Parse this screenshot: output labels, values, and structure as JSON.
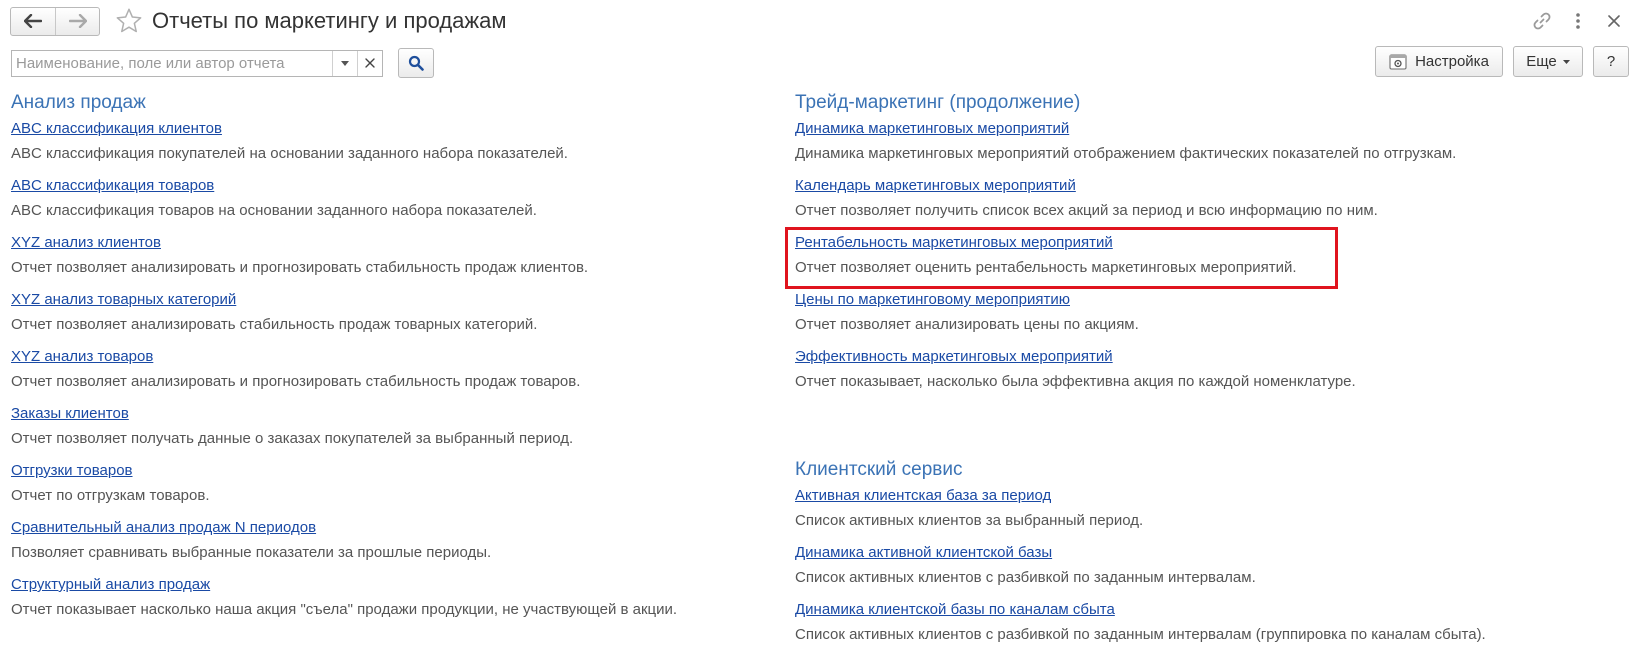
{
  "title": "Отчеты по маркетингу и продажам",
  "nav": {
    "back_icon": "arrow-left-icon",
    "forward_icon": "arrow-right-icon",
    "favorite_icon": "star-icon"
  },
  "window_icons": [
    "link-icon",
    "more-vertical-icon",
    "close-icon"
  ],
  "search": {
    "placeholder": "Наименование, поле или автор отчета",
    "value": ""
  },
  "toolbar": {
    "settings_label": "Настройка",
    "more_label": "Еще",
    "help_label": "?"
  },
  "left_column": {
    "sections": [
      {
        "title": "Анализ продаж",
        "reports": [
          {
            "name": "ABC классификация клиентов",
            "description": "ABC классификация покупателей на основании заданного набора показателей."
          },
          {
            "name": "ABC классификация товаров",
            "description": "ABC классификация товаров на основании заданного набора показателей."
          },
          {
            "name": "XYZ анализ клиентов",
            "description": "Отчет позволяет анализировать и прогнозировать стабильность продаж клиентов."
          },
          {
            "name": "XYZ анализ товарных категорий",
            "description": "Отчет позволяет анализировать стабильность продаж товарных категорий."
          },
          {
            "name": "XYZ анализ товаров",
            "description": "Отчет позволяет анализировать и прогнозировать стабильность продаж товаров."
          },
          {
            "name": "Заказы клиентов",
            "description": "Отчет позволяет получать данные о заказах покупателей за выбранный период."
          },
          {
            "name": "Отгрузки товаров",
            "description": "Отчет по отгрузкам товаров."
          },
          {
            "name": "Сравнительный анализ продаж N периодов",
            "description": "Позволяет сравнивать выбранные показатели за прошлые периоды."
          },
          {
            "name": "Структурный анализ продаж",
            "description": "Отчет показывает насколько наша акция \"съела\" продажи продукции, не участвующей в акции."
          }
        ]
      }
    ]
  },
  "right_column": {
    "sections": [
      {
        "title": "Трейд-маркетинг (продолжение)",
        "reports": [
          {
            "name": "Динамика маркетинговых мероприятий",
            "description": "Динамика маркетинговых мероприятий отображением фактических показателей по отгрузкам."
          },
          {
            "name": "Календарь маркетинговых мероприятий",
            "description": "Отчет позволяет получить список всех акций за период и всю информацию по ним."
          },
          {
            "name": "Рентабельность маркетинговых мероприятий",
            "description": "Отчет позволяет оценить рентабельность маркетинговых мероприятий.",
            "highlighted": true
          },
          {
            "name": "Цены по маркетинговому мероприятию",
            "description": "Отчет позволяет анализировать цены по акциям."
          },
          {
            "name": "Эффективность маркетинговых мероприятий",
            "description": "Отчет показывает, насколько была эффективна акция по каждой номенклатуре."
          }
        ]
      },
      {
        "title": "Клиентский сервис",
        "reports": [
          {
            "name": "Активная клиентская база за период",
            "description": "Список активных клиентов за выбранный период."
          },
          {
            "name": "Динамика активной клиентской базы",
            "description": "Список активных клиентов с разбивкой по заданным интервалам."
          },
          {
            "name": "Динамика клиентской базы по каналам сбыта",
            "description": "Список активных клиентов с разбивкой по заданным интервалам (группировка по каналам сбыта)."
          }
        ]
      }
    ]
  },
  "highlight_color": "#e0141e",
  "link_color": "#1a4aa5",
  "section_title_color": "#3b73b5"
}
